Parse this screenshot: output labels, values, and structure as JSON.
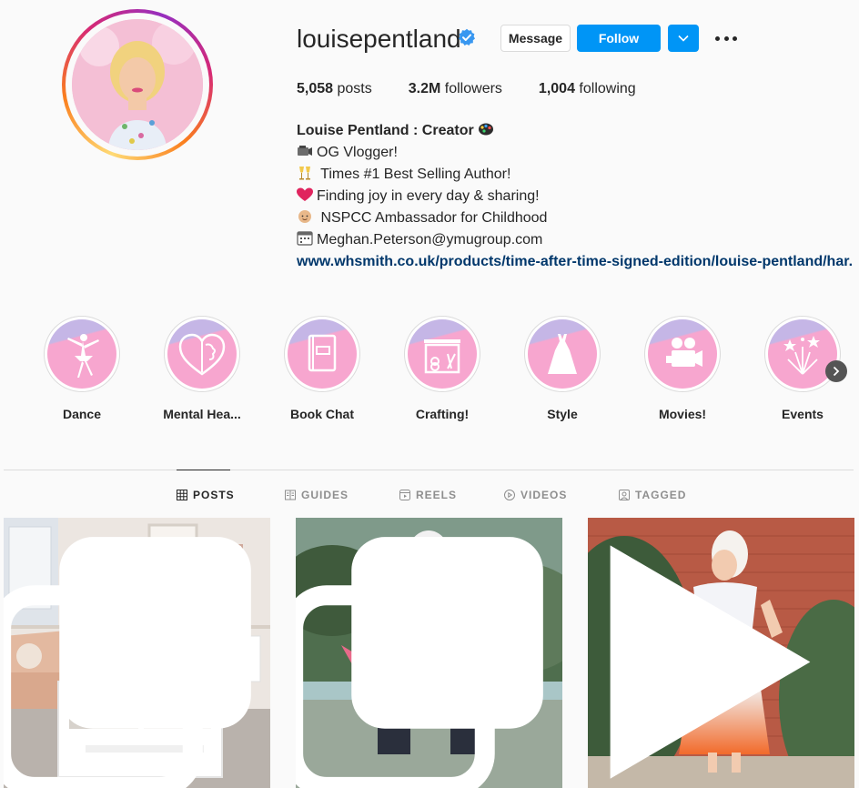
{
  "profile": {
    "username": "louisepentland",
    "verified": true,
    "buttons": {
      "message": "Message",
      "follow": "Follow"
    },
    "stats": {
      "posts_count": "5,058",
      "posts_label": "posts",
      "followers_count": "3.2M",
      "followers_label": "followers",
      "following_count": "1,004",
      "following_label": "following"
    },
    "bio": {
      "name": "Louise Pentland : Creator",
      "lines": [
        "OG Vlogger!",
        " Times #1 Best Selling Author!",
        "Finding joy in every day & sharing!",
        " NSPCC Ambassador for Childhood",
        "Meghan.Peterson@ymugroup.com"
      ],
      "link": "www.whsmith.co.uk/products/time-after-time-signed-edition/louise-pentland/har..."
    }
  },
  "highlights": [
    {
      "label": "Dance",
      "icon": "ballerina-icon"
    },
    {
      "label": "Mental Hea...",
      "icon": "heart-brain-icon"
    },
    {
      "label": "Book Chat",
      "icon": "book-icon"
    },
    {
      "label": "Crafting!",
      "icon": "craft-supplies-icon"
    },
    {
      "label": "Style",
      "icon": "dress-icon"
    },
    {
      "label": "Movies!",
      "icon": "movie-camera-icon"
    },
    {
      "label": "Events",
      "icon": "fireworks-icon"
    }
  ],
  "tabs": [
    {
      "label": "POSTS",
      "icon": "grid-icon",
      "active": true
    },
    {
      "label": "GUIDES",
      "icon": "guide-icon",
      "active": false
    },
    {
      "label": "REELS",
      "icon": "reels-icon",
      "active": false
    },
    {
      "label": "VIDEOS",
      "icon": "play-icon",
      "active": false
    },
    {
      "label": "TAGGED",
      "icon": "tag-icon",
      "active": false
    }
  ],
  "colors": {
    "accent": "#0095f6",
    "link": "#00376b",
    "text": "#262626",
    "muted": "#8e8e8e"
  }
}
